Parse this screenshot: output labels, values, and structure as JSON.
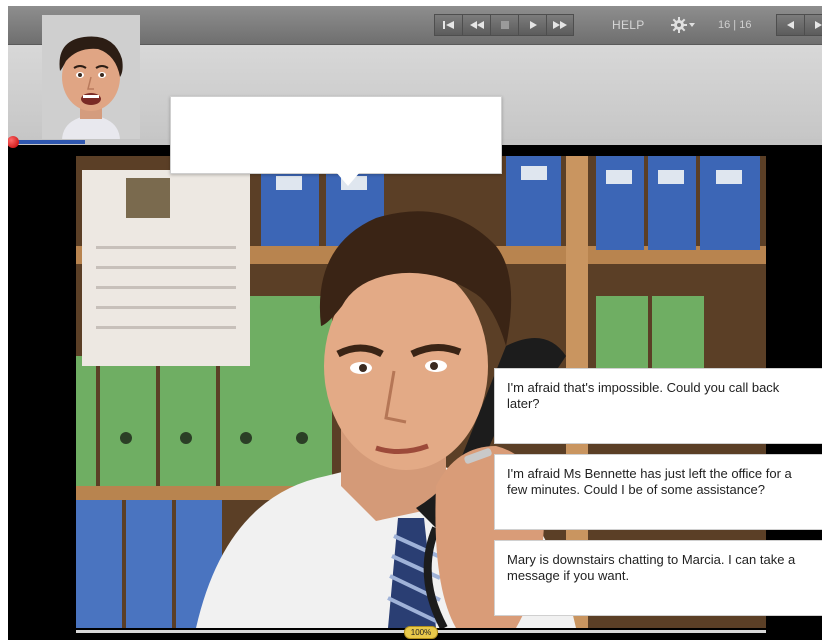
{
  "toolbar": {
    "controls": [
      {
        "name": "first-slide-icon"
      },
      {
        "name": "rewind-icon"
      },
      {
        "name": "stop-icon"
      },
      {
        "name": "play-icon"
      },
      {
        "name": "fast-forward-icon"
      }
    ],
    "help_label": "HELP",
    "settings_icon": "gear-icon",
    "page_counter": "16 | 16",
    "nav": [
      {
        "name": "previous-icon"
      },
      {
        "name": "next-icon"
      }
    ]
  },
  "progress": {
    "value": 0.095
  },
  "options": [
    {
      "text": "I'm afraid that's impossible. Could you call back later?"
    },
    {
      "text": "I'm afraid Ms Bennette has just left the office for a few minutes. Could I be of some assistance?"
    },
    {
      "text": "Mary is downstairs chatting to Marcia. I can take a message if you want."
    }
  ],
  "zoom": {
    "label": "100%"
  },
  "colors": {
    "toolbar": "#7d7d7d",
    "progress_fill": "#2f57b0",
    "progress_dot": "#c00000",
    "zoom_badge": "#e8c94a"
  }
}
